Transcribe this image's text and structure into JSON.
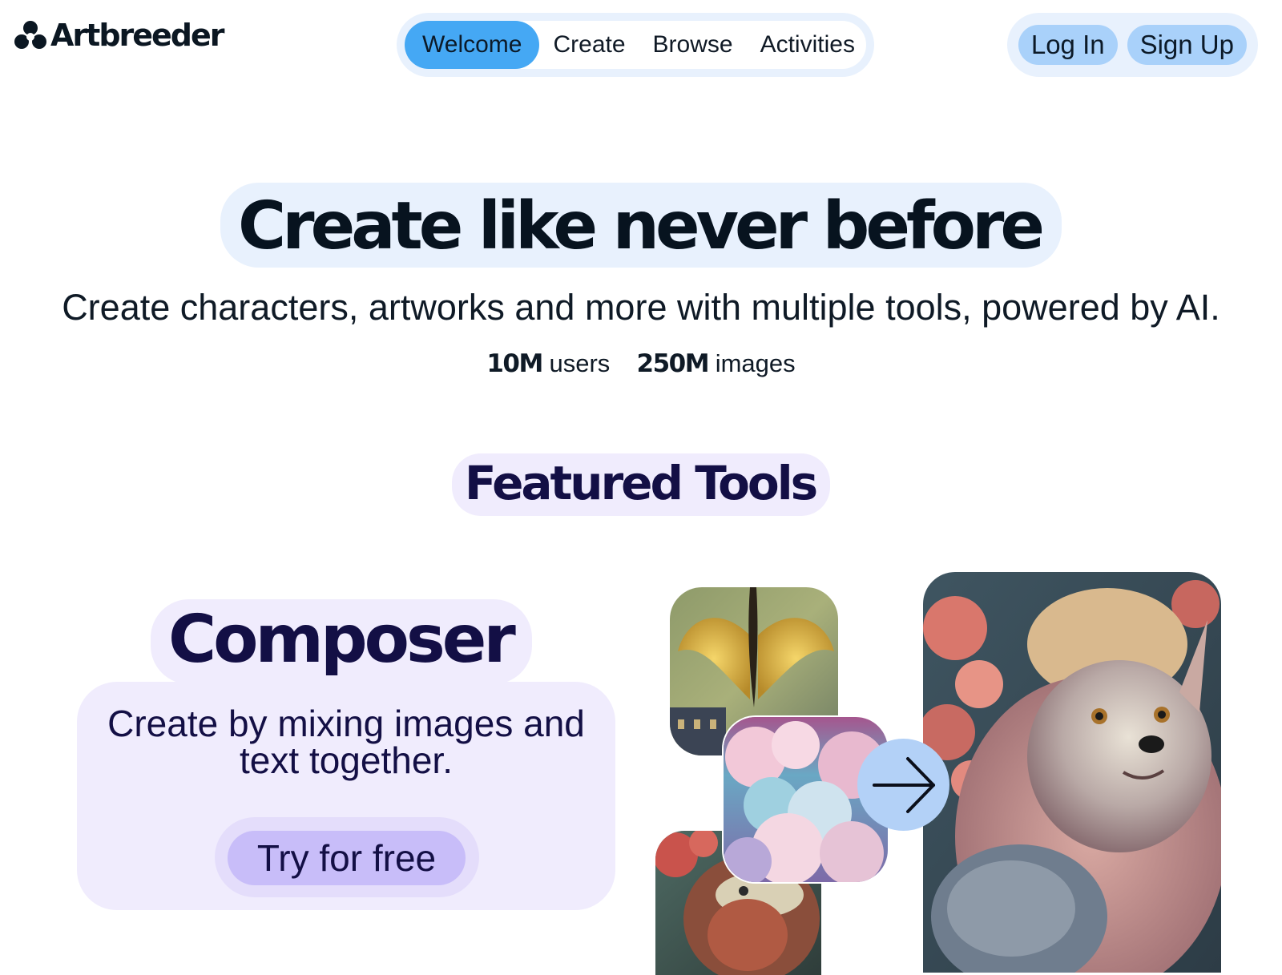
{
  "brand": {
    "name": "Artbreeder",
    "logo_icon": "trefoil-logo-icon"
  },
  "nav": {
    "items": [
      {
        "label": "Welcome",
        "active": true
      },
      {
        "label": "Create",
        "active": false
      },
      {
        "label": "Browse",
        "active": false
      },
      {
        "label": "Activities",
        "active": false
      }
    ]
  },
  "auth": {
    "login_label": "Log In",
    "signup_label": "Sign Up"
  },
  "hero": {
    "title": "Create like never before",
    "subtitle": "Create characters, artworks and more with multiple tools, powered by AI.",
    "stats": [
      {
        "value": "10M",
        "label": "users"
      },
      {
        "value": "250M",
        "label": "images"
      }
    ]
  },
  "featured": {
    "heading": "Featured Tools",
    "tool": {
      "name": "Composer",
      "description_line1": "Create by mixing images and",
      "description_line2": "text together.",
      "cta_label": "Try for free",
      "arrow_icon": "arrow-right-icon"
    }
  },
  "colors": {
    "nav_active": "#45a8f4",
    "auth_button": "#a9d1fa",
    "pill_blue": "#e8f1fd",
    "pill_lavender": "#f0ecfd",
    "cta": "#c8bdf9",
    "heading_navy": "#130f45"
  }
}
